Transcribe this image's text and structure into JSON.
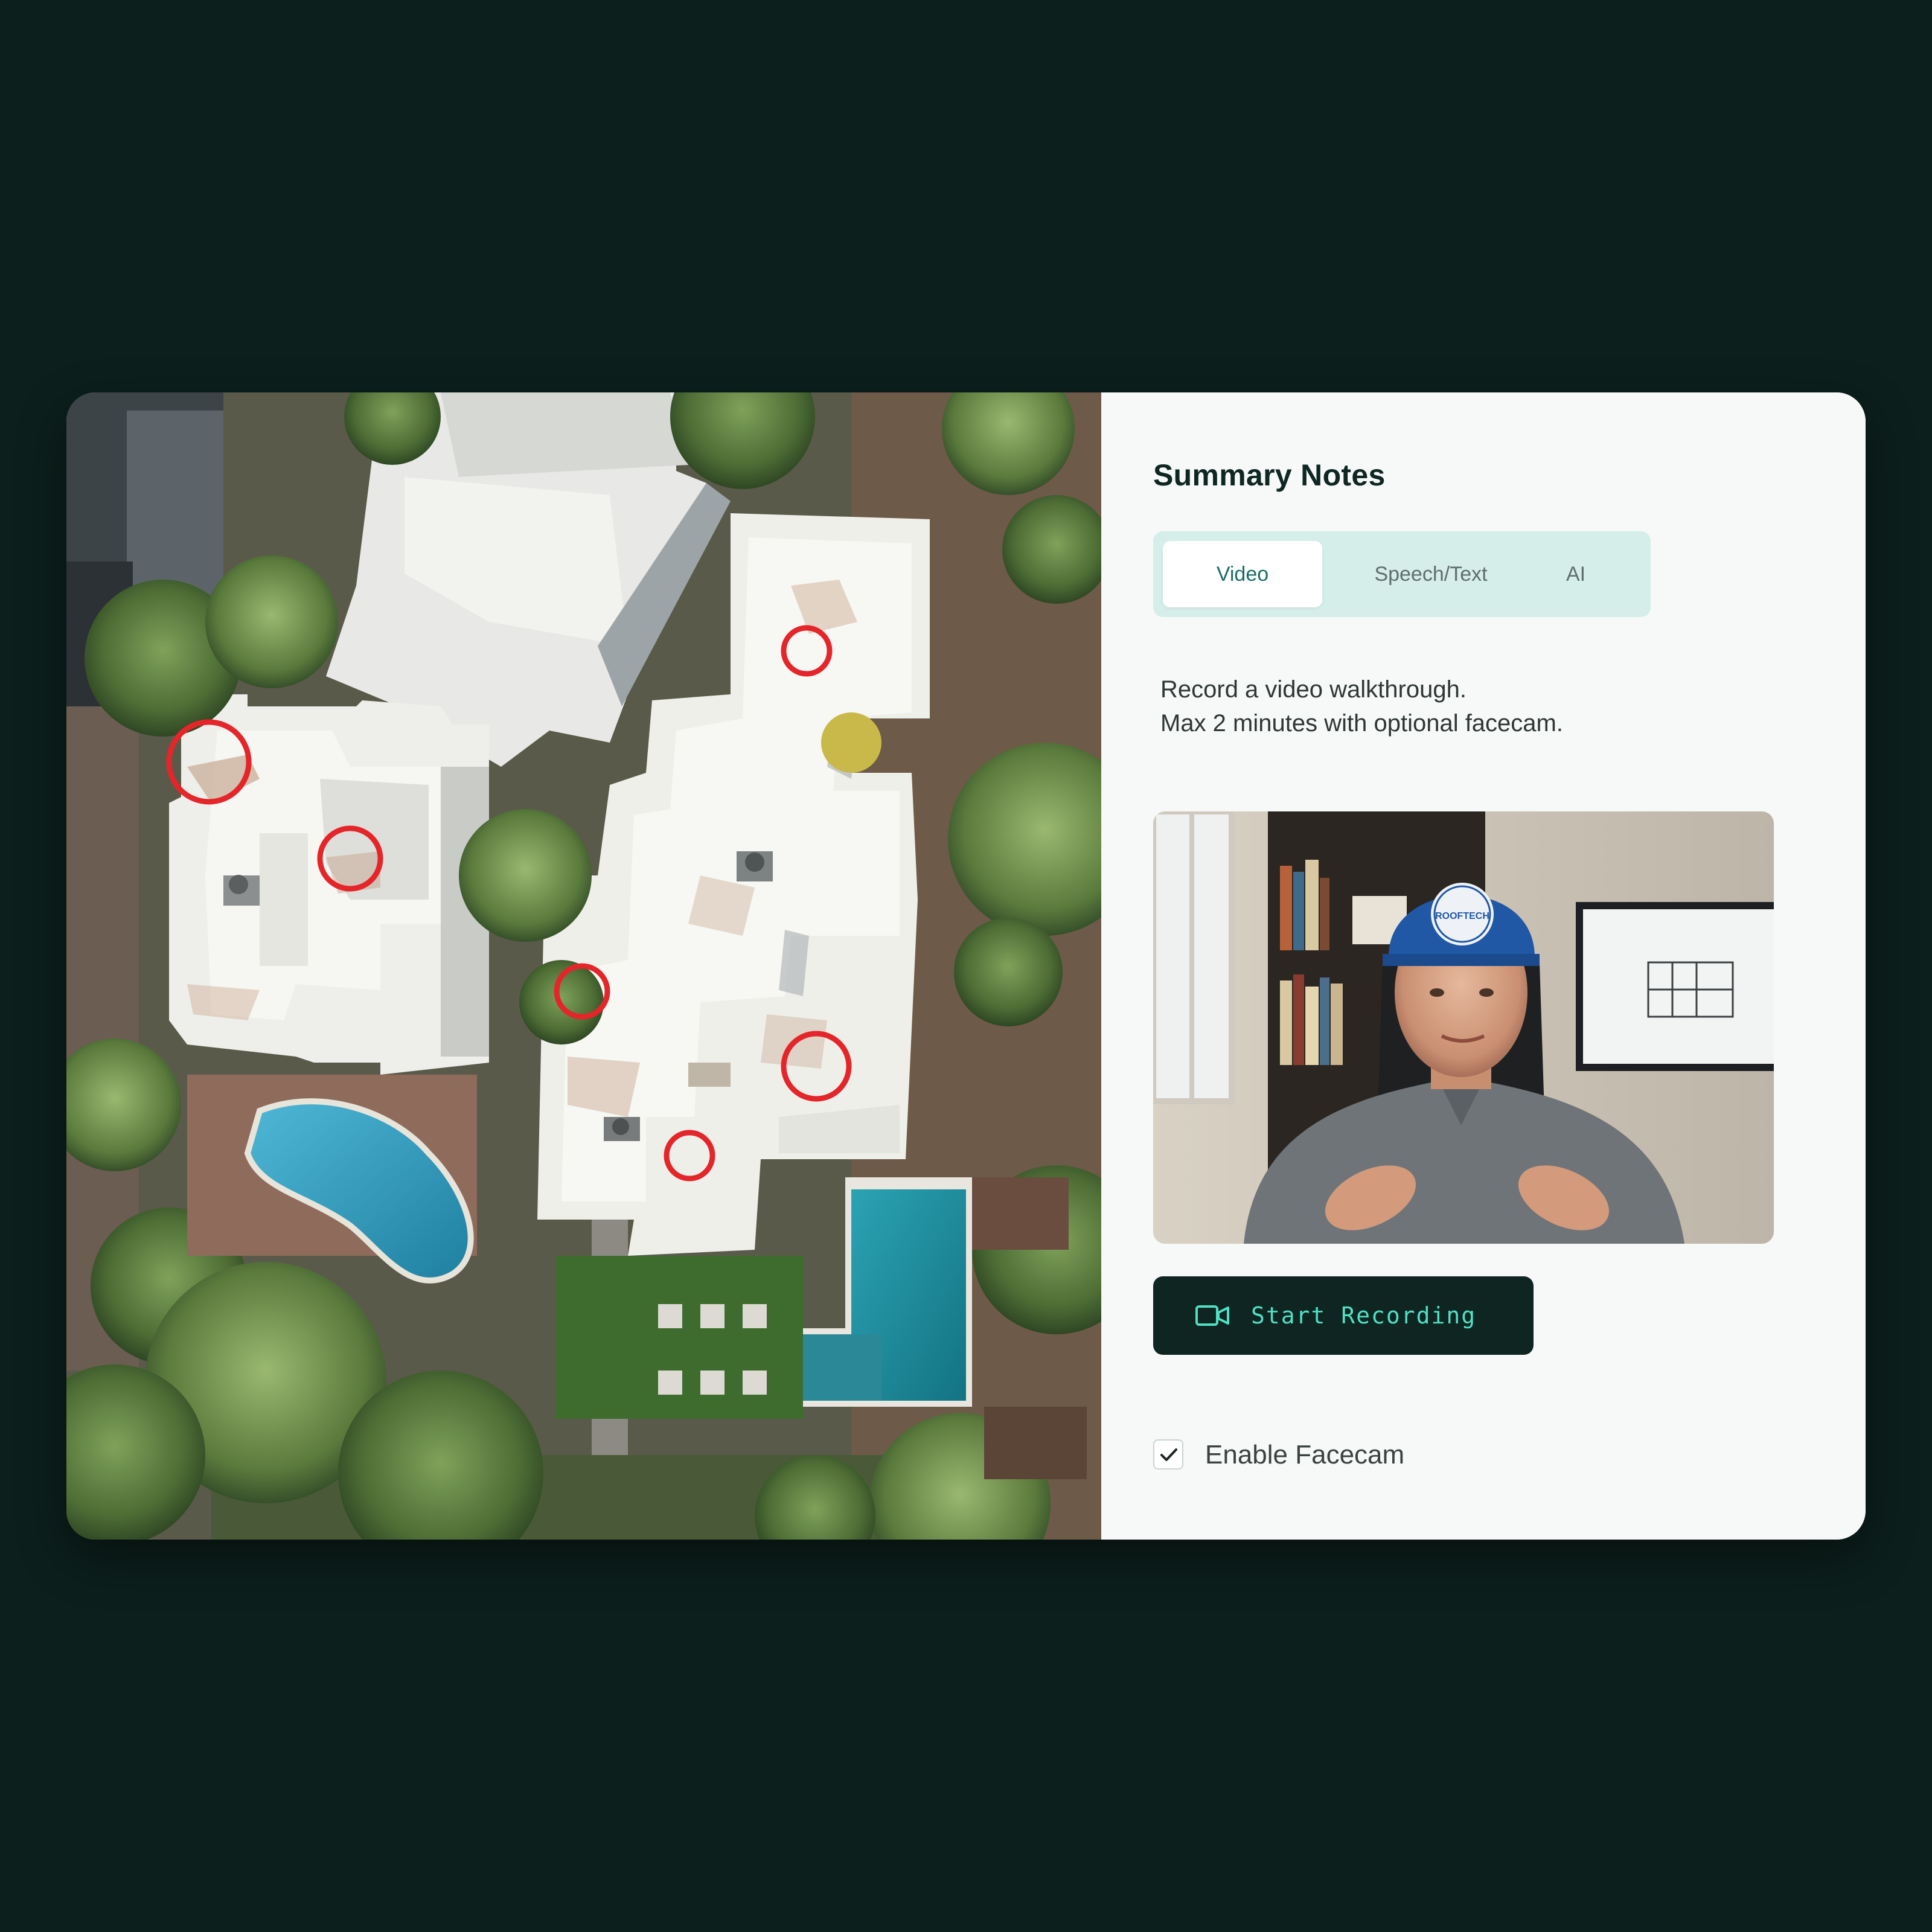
{
  "panel": {
    "title": "Summary Notes",
    "tabs": [
      {
        "label": "Video",
        "active": true
      },
      {
        "label": "Speech/Text",
        "active": false
      },
      {
        "label": "AI",
        "active": false
      }
    ],
    "description": [
      "Record a video walkthrough.",
      "Max 2 minutes with optional facecam."
    ],
    "record_button": {
      "label": "Start Recording",
      "icon": "video-camera-icon"
    },
    "facecam_option": {
      "label": "Enable Facecam",
      "checked": true
    }
  },
  "aerial": {
    "marker_color": "#e4252a",
    "marker_count": 6
  },
  "facecam_preview": {
    "cap_text": "ROOFTECH"
  },
  "colors": {
    "page_background": "#0c1f1c",
    "card_background": "#f6f9f8",
    "tab_track": "#d5eee9",
    "active_tab_text": "#1a6e66",
    "button_background": "#0f2521",
    "button_text": "#4fe0c4"
  }
}
